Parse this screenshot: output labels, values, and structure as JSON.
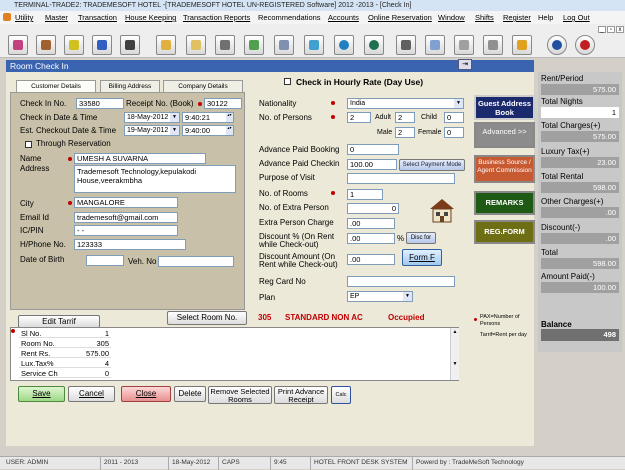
{
  "window": {
    "title": "TERMINAL-TRADE2: TRADEMESOFT HOTEL -[TRADEMESOFT HOTEL UN-REGISTERED Software] 2012 -2013 - [Check In]",
    "form_title": "Room Check In"
  },
  "menu": [
    "Utility",
    "Master",
    "Transaction",
    "House Keeping",
    "Transaction Reports",
    "Recommendations",
    "Accounts",
    "Online Reservation",
    "Window",
    "Shifts",
    "Register",
    "Help",
    "Log Out"
  ],
  "toolbar_icons": [
    "reservation-icon",
    "guest-icon",
    "checkin-icon",
    "wizard-icon",
    "search-binoculars-icon",
    "folder-search-icon",
    "export-icon",
    "download-icon",
    "chart-icon",
    "document-icon",
    "arrows-icon",
    "globe-icon",
    "earth-icon",
    "settings-icon",
    "notes-icon",
    "network-icon",
    "calculator-icon",
    "lock-icon",
    "help-icon",
    "close-icon"
  ],
  "tabs": {
    "customer": "Customer Details",
    "billing": "Billing Address",
    "company": "Company Details"
  },
  "customer": {
    "checkin_no_label": "Check In No.",
    "checkin_no": "33580",
    "receipt_no_label": "Receipt No. (Book)",
    "receipt_no": "30122",
    "checkin_dt_label": "Check in Date & Time",
    "checkin_date": "18-May-2012",
    "checkin_time": "9:40:21",
    "checkout_dt_label": "Est. Checkout Date & Time",
    "checkout_date": "19-May-2012",
    "checkout_time": "9:40:00",
    "through_res_label": "Through Reservation",
    "name_label": "Name",
    "name": "UMESH A SUVARNA",
    "address_label": "Address",
    "address_line1": "Trademesoft Technology,kepulakodi",
    "address_line2": "House,veerakmbha",
    "city_label": "City",
    "city": "MANGALORE",
    "email_label": "Email Id",
    "email": "trademesoft@gmail.com",
    "icpin_label": "IC/PIN",
    "icpin": "  -   -",
    "phone_label": "H/Phone No.",
    "phone": "123333",
    "dob_label": "Date of Birth",
    "veh_label": "Veh. No"
  },
  "hourly_label": "Check in Hourly Rate (Day Use)",
  "stay": {
    "nationality_label": "Nationality",
    "nationality": "India",
    "persons_label": "No. of Persons",
    "persons": "2",
    "adult_label": "Adult",
    "adult": "2",
    "child_label": "Child",
    "child": "0",
    "male_label": "Male",
    "male": "2",
    "female_label": "Female",
    "female": "0",
    "adv_booking_label": "Advance Paid Booking",
    "adv_booking": "0",
    "adv_checkin_label": "Advance Paid Checkin",
    "adv_checkin": "100.00",
    "payment_mode_button": "Select Payment Mode",
    "purpose_label": "Purpose of Visit",
    "rooms_label": "No. of Rooms",
    "rooms": "1",
    "extra_persons_label": "No. of Extra Person",
    "extra_persons": "0",
    "extra_charge_label": "Extra Person Charge",
    "extra_charge": ".00",
    "discount_pct_label": "Discount % (On Rent while Check-out)",
    "discount_pct": ".00",
    "pct_symbol": "%",
    "disc_for_button": "Disc for",
    "discount_amt_label": "Discount Amount (On Rent while Check-out)",
    "discount_amt": ".00",
    "formf_button": "Form F",
    "reg_card_label": "Reg Card No",
    "plan_label": "Plan",
    "plan": "EP"
  },
  "side_buttons": {
    "guest_book": "Guest Address Book",
    "advanced": "Advanced >>",
    "business_source": "Business Source / Agent Commission",
    "remarks": "REMARKS",
    "reg_form": "REG.FORM"
  },
  "summary": {
    "rent_label": "Rent/Period",
    "rent": "575.00",
    "nights_label": "Total Nights",
    "nights": "1",
    "charges_label": "Total Charges(+)",
    "charges": "575.00",
    "luxury_label": "Luxury Tax(+)",
    "luxury": "23.00",
    "rental_label": "Total Rental",
    "rental": "598.00",
    "other_label": "Other Charges(+)",
    "other": ".00",
    "discount_label": "Discount(-)",
    "discount": ".00",
    "total_label": "Total",
    "total": "598.00",
    "paid_label": "Amount Paid(-)",
    "paid": "100.00",
    "balance_label": "Balance",
    "balance": "498"
  },
  "room": {
    "edit_tariff": "Edit Tarrif",
    "select_room": "Select Room No.",
    "room_no": "305",
    "room_type": "STANDARD NON AC",
    "room_status": "Occupied",
    "legend1": "PAX=Number of Persons",
    "legend2": "Tarrif=Rent per day"
  },
  "grid_rows": [
    {
      "label": "Sl No.",
      "value": "1"
    },
    {
      "label": "Room No.",
      "value": "305"
    },
    {
      "label": "Rent Rs.",
      "value": "575.00"
    },
    {
      "label": "Lux.Tax%",
      "value": "4"
    },
    {
      "label": "Service Ch",
      "value": "0"
    }
  ],
  "actions": {
    "save": "Save",
    "cancel": "Cancel",
    "close": "Close",
    "delete": "Delete",
    "remove": "Remove Selected Rooms",
    "print": "Print Advance Receipt",
    "calc": "Calc"
  },
  "status": {
    "user": "USER: ADMIN",
    "year": "2011 - 2013",
    "date": "18-May-2012",
    "caps": "CAPS",
    "time": "9:45",
    "system": "HOTEL FRONT DESK SYSTEM",
    "powered": "Powerd by : TradeMeSoft Technology"
  },
  "colors": {
    "title_blue": "#3a63b0",
    "guest_book": "#1a2a6c",
    "advanced": "#8c8c8c",
    "business": "#c85a32",
    "remarks": "#1e5a14",
    "reg_form": "#6e6e14",
    "req_red": "#c00000"
  }
}
